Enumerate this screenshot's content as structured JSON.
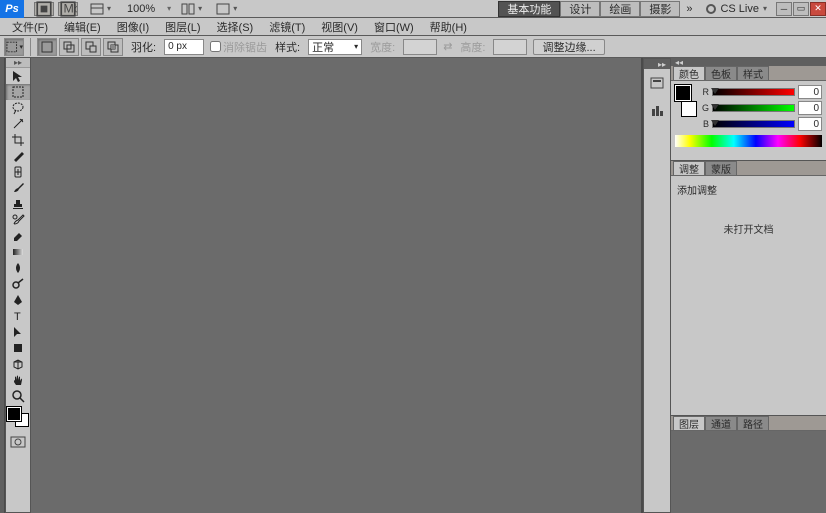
{
  "topbar": {
    "logo": "Ps",
    "zoom": "100%",
    "cslive": "CS Live"
  },
  "workspaces": {
    "essentials": "基本功能",
    "design": "设计",
    "painting": "绘画",
    "photography": "摄影",
    "more": "»"
  },
  "menu": {
    "file": "文件(F)",
    "edit": "编辑(E)",
    "image": "图像(I)",
    "layer": "图层(L)",
    "select": "选择(S)",
    "filter": "滤镜(T)",
    "view": "视图(V)",
    "window": "窗口(W)",
    "help": "帮助(H)"
  },
  "options": {
    "feather_label": "羽化:",
    "feather_value": "0 px",
    "antialias": "消除锯齿",
    "style_label": "样式:",
    "style_value": "正常",
    "width_label": "宽度:",
    "height_label": "高度:",
    "refine": "调整边缘..."
  },
  "panels": {
    "color_tabs": {
      "color": "颜色",
      "swatches": "色板",
      "styles": "样式"
    },
    "rgb": {
      "r": "R",
      "g": "G",
      "b": "B",
      "r_val": "0",
      "g_val": "0",
      "b_val": "0"
    },
    "adj_tabs": {
      "adjustments": "调整",
      "masks": "蒙版"
    },
    "adj_title": "添加调整",
    "adj_msg": "未打开文档",
    "layer_tabs": {
      "layers": "图层",
      "channels": "通道",
      "paths": "路径"
    }
  }
}
